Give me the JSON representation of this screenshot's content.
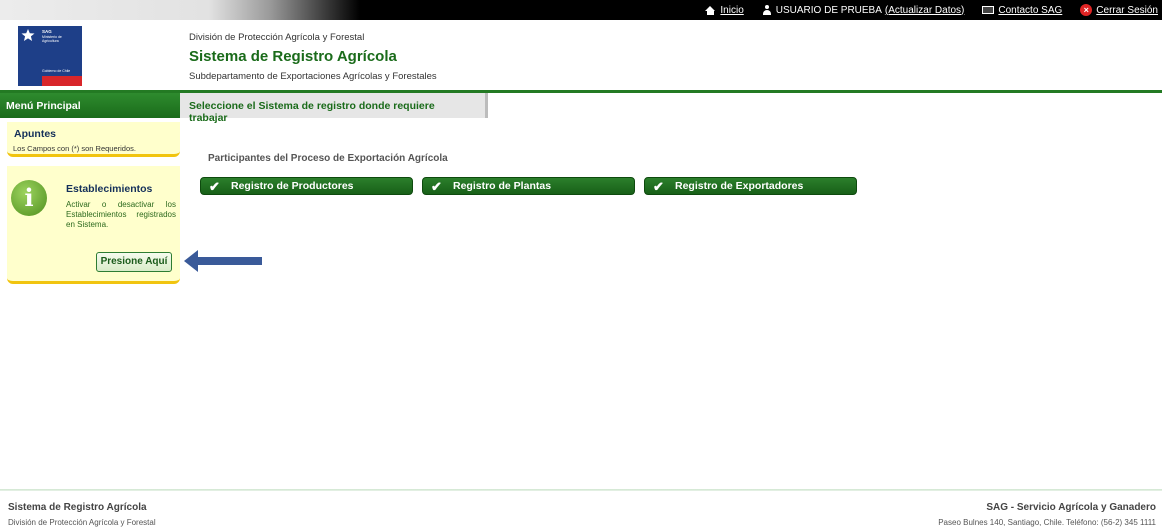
{
  "topnav": {
    "inicio": "Inicio",
    "user": "USUARIO DE PRUEBA",
    "actualizar": "(Actualizar Datos)",
    "contacto": "Contacto SAG",
    "cerrar": "Cerrar Sesión",
    "icons": [
      "home-icon",
      "user-icon",
      "mail-icon",
      "close-icon"
    ]
  },
  "logo": {
    "line1": "SAG",
    "line2": "Ministerio de Agricultura",
    "line3": "Gobierno de Chile"
  },
  "header": {
    "division": "División de Protección Agrícola y Forestal",
    "title": "Sistema de Registro Agrícola",
    "subdepartamento": "Subdepartamento de Exportaciones Agrícolas y Forestales"
  },
  "menu": {
    "title": "Menú Principal"
  },
  "tab": {
    "label": "Seleccione el Sistema de registro donde requiere trabajar"
  },
  "sidebar": {
    "apuntes_title": "Apuntes",
    "apuntes_note": "Los Campos con (*) son Requeridos.",
    "establecimientos_title": "Establecimientos",
    "establecimientos_desc": "Activar o desactivar los Establecimientos registrados en Sistema.",
    "presione_label": "Presione Aquí"
  },
  "main": {
    "section_title": "Participantes del Proceso de Exportación Agrícola",
    "registros": [
      {
        "label": "Registro de Productores"
      },
      {
        "label": "Registro de Plantas"
      },
      {
        "label": "Registro de Exportadores"
      }
    ]
  },
  "footer": {
    "left_title": "Sistema de Registro Agrícola",
    "left_sub": "División de Protección Agrícola y Forestal",
    "right_title": "SAG - Servicio Agrícola y Ganadero",
    "right_sub": "Paseo Bulnes 140, Santiago, Chile. Teléfono: (56-2) 345 1111"
  },
  "colors": {
    "brand_green": "#1a6b1a",
    "note_yellow": "#ffffcc",
    "arrow_blue": "#3a5a99"
  }
}
